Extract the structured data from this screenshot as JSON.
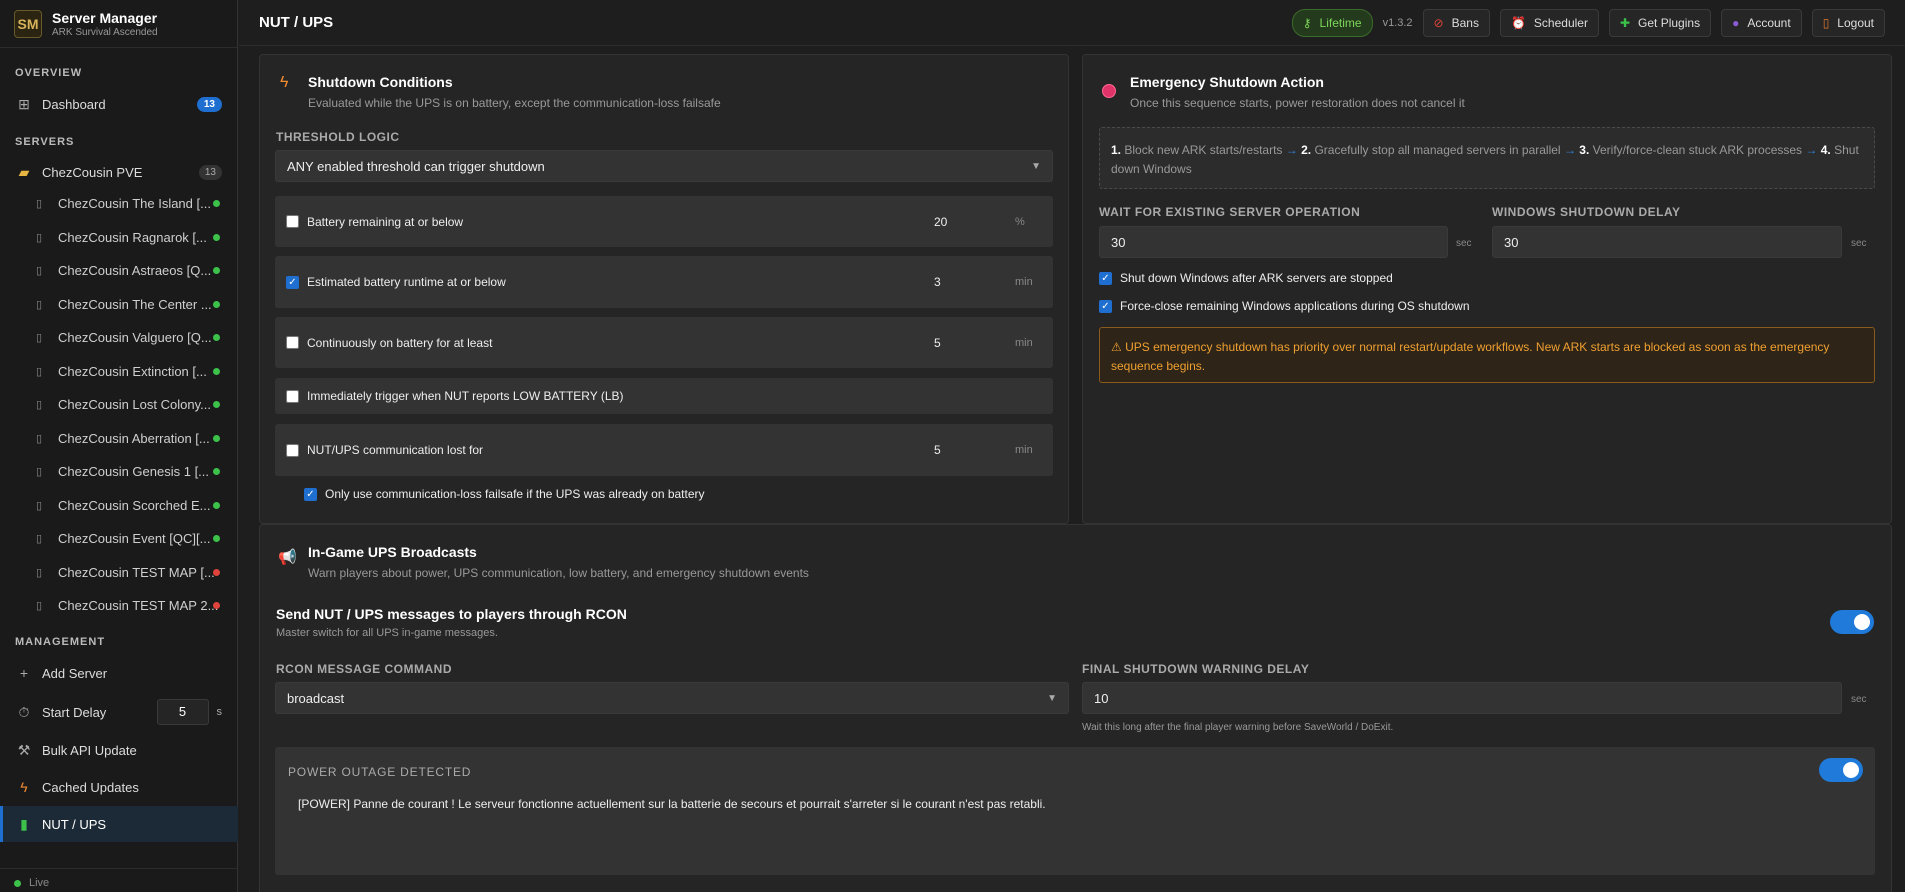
{
  "brand": {
    "title": "Server Manager",
    "subtitle": "ARK Survival Ascended",
    "logo_text": "SM"
  },
  "sidebar": {
    "overview_label": "OVERVIEW",
    "dashboard": {
      "label": "Dashboard",
      "badge": "13"
    },
    "servers_label": "SERVERS",
    "cluster": {
      "label": "ChezCousin PVE",
      "count": "13"
    },
    "servers": [
      {
        "name": "ChezCousin The Island [...",
        "status": "online"
      },
      {
        "name": "ChezCousin Ragnarok [...",
        "status": "online"
      },
      {
        "name": "ChezCousin Astraeos [Q...",
        "status": "online"
      },
      {
        "name": "ChezCousin The Center ...",
        "status": "online"
      },
      {
        "name": "ChezCousin Valguero [Q...",
        "status": "online"
      },
      {
        "name": "ChezCousin Extinction [...",
        "status": "online"
      },
      {
        "name": "ChezCousin Lost Colony...",
        "status": "online"
      },
      {
        "name": "ChezCousin Aberration [...",
        "status": "online"
      },
      {
        "name": "ChezCousin Genesis 1 [...",
        "status": "online"
      },
      {
        "name": "ChezCousin Scorched E...",
        "status": "online"
      },
      {
        "name": "ChezCousin Event [QC][...",
        "status": "online"
      },
      {
        "name": "ChezCousin TEST MAP [...",
        "status": "offline"
      },
      {
        "name": "ChezCousin TEST MAP 2...",
        "status": "offline"
      }
    ],
    "management_label": "MANAGEMENT",
    "add_server": "Add Server",
    "start_delay": {
      "label": "Start Delay",
      "value": "5",
      "unit": "s"
    },
    "bulk_api": "Bulk API Update",
    "cached_updates": "Cached Updates",
    "nut_ups": "NUT / UPS",
    "live": "Live"
  },
  "colors": {
    "online": "#3cc24a",
    "offline": "#e0433b",
    "accent": "#1f6fd1",
    "warning": "#f0a030"
  },
  "topbar": {
    "title": "NUT / UPS",
    "lifetime": "Lifetime",
    "version": "v1.3.2",
    "bans": "Bans",
    "scheduler": "Scheduler",
    "plugins": "Get Plugins",
    "account": "Account",
    "logout": "Logout"
  },
  "shutdown": {
    "title": "Shutdown Conditions",
    "subtitle": "Evaluated while the UPS is on battery, except the communication-loss failsafe",
    "logic_label": "THRESHOLD LOGIC",
    "logic_value": "ANY enabled threshold can trigger shutdown",
    "rows": [
      {
        "label": "Battery remaining at or below",
        "checked": false,
        "value": "20",
        "unit": "%"
      },
      {
        "label": "Estimated battery runtime at or below",
        "checked": true,
        "value": "3",
        "unit": "min"
      },
      {
        "label": "Continuously on battery for at least",
        "checked": false,
        "value": "5",
        "unit": "min"
      },
      {
        "label": "Immediately trigger when NUT reports LOW BATTERY (LB)",
        "checked": false
      },
      {
        "label": "NUT/UPS communication lost for",
        "checked": false,
        "value": "5",
        "unit": "min"
      }
    ],
    "failsafe": {
      "label": "Only use communication-loss failsafe if the UPS was already on battery",
      "checked": true
    }
  },
  "emergency": {
    "title": "Emergency Shutdown Action",
    "subtitle": "Once this sequence starts, power restoration does not cancel it",
    "steps": [
      {
        "n": "1.",
        "text": "Block new ARK starts/restarts"
      },
      {
        "n": "2.",
        "text": "Gracefully stop all managed servers in parallel"
      },
      {
        "n": "3.",
        "text": "Verify/force-clean stuck ARK processes"
      },
      {
        "n": "4.",
        "text": "Shut down Windows"
      }
    ],
    "wait_label": "WAIT FOR EXISTING SERVER OPERATION",
    "wait_value": "30",
    "wait_unit": "sec",
    "win_delay_label": "WINDOWS SHUTDOWN DELAY",
    "win_delay_value": "30",
    "win_delay_unit": "sec",
    "check1": "Shut down Windows after ARK servers are stopped",
    "check2": "Force-close remaining Windows applications during OS shutdown",
    "warning": "⚠ UPS emergency shutdown has priority over normal restart/update workflows. New ARK starts are blocked as soon as the emergency sequence begins."
  },
  "broadcasts": {
    "title": "In-Game UPS Broadcasts",
    "subtitle": "Warn players about power, UPS communication, low battery, and emergency shutdown events",
    "master_title": "Send NUT / UPS messages to players through RCON",
    "master_sub": "Master switch for all UPS in-game messages.",
    "rcon_label": "RCON MESSAGE COMMAND",
    "rcon_value": "broadcast",
    "final_label": "FINAL SHUTDOWN WARNING DELAY",
    "final_value": "10",
    "final_unit": "sec",
    "final_help": "Wait this long after the final player warning before SaveWorld / DoExit.",
    "power_label": "POWER OUTAGE DETECTED",
    "power_msg": "[POWER] Panne de courant ! Le serveur fonctionne actuellement sur la batterie de secours et pourrait s'arreter si le courant n'est pas retabli."
  }
}
